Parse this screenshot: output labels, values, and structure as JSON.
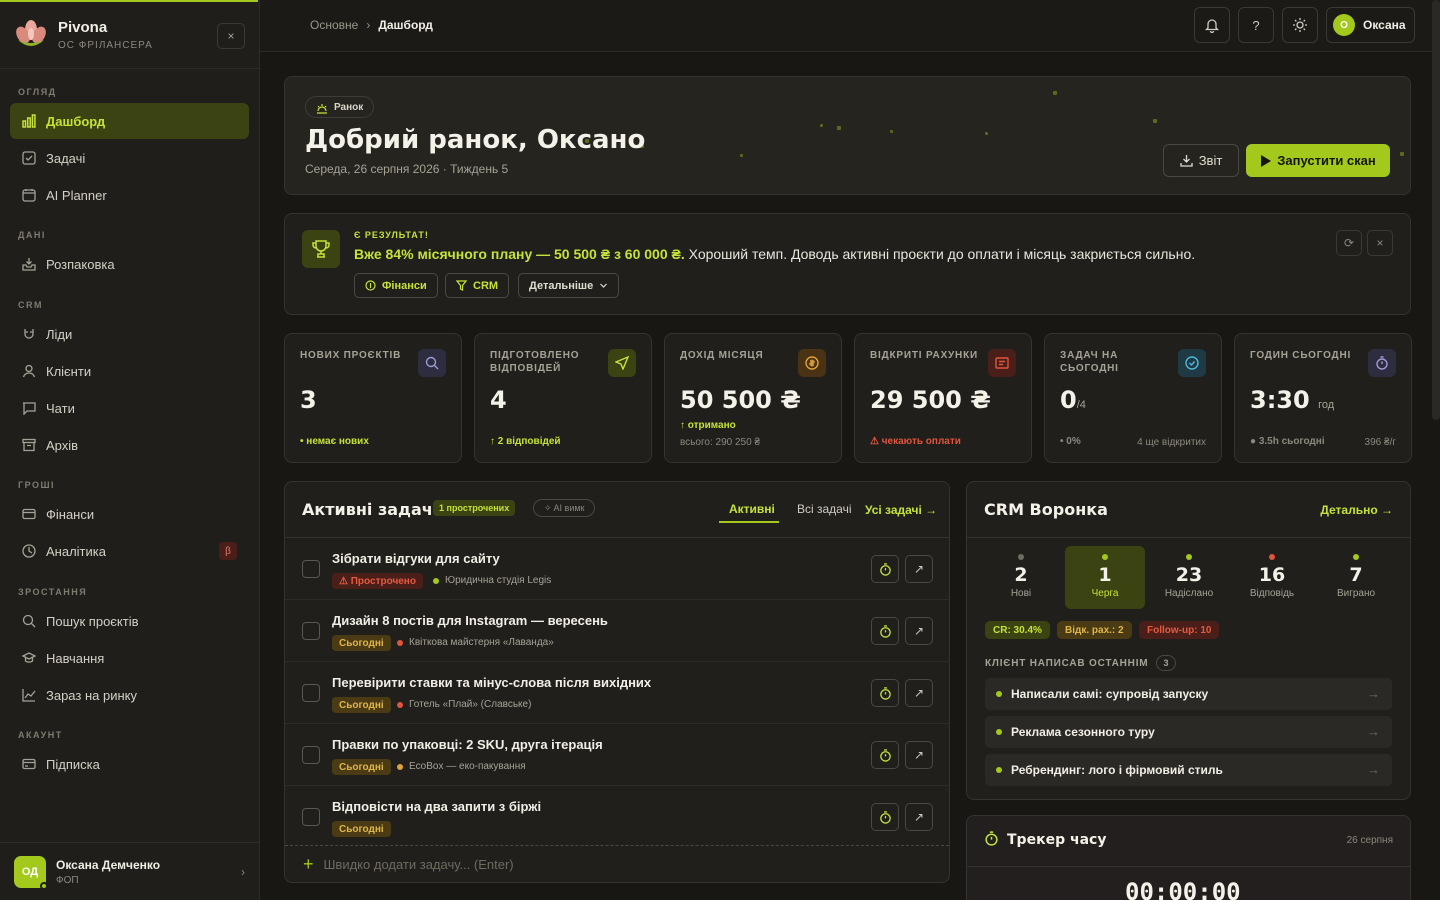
{
  "app": {
    "name": "Pivona",
    "subtitle": "ОС ФРІЛАНСЕРА",
    "close_glyph": "×"
  },
  "sidebar": {
    "sections": [
      {
        "label": "ОГЛЯД"
      },
      {
        "label": "ДАНІ"
      },
      {
        "label": "CRM"
      },
      {
        "label": "ГРОШІ"
      },
      {
        "label": "ЗРОСТАННЯ"
      },
      {
        "label": "АКАУНТ"
      }
    ],
    "items": [
      {
        "label": "Дашборд",
        "icon": "bar-chart-icon",
        "active": true
      },
      {
        "label": "Задачі",
        "icon": "checkbox-icon"
      },
      {
        "label": "AI Planner",
        "icon": "calendar-icon"
      },
      {
        "label": "Розпаковка",
        "icon": "inbox-icon"
      },
      {
        "label": "Ліди",
        "icon": "magnet-icon"
      },
      {
        "label": "Клієнти",
        "icon": "user-icon"
      },
      {
        "label": "Чати",
        "icon": "chat-icon"
      },
      {
        "label": "Архів",
        "icon": "archive-icon"
      },
      {
        "label": "Фінанси",
        "icon": "wallet-icon"
      },
      {
        "label": "Аналітика",
        "icon": "clock-chart-icon",
        "badge": "β"
      },
      {
        "label": "Пошук проєктів",
        "icon": "search-icon"
      },
      {
        "label": "Навчання",
        "icon": "graduation-icon"
      },
      {
        "label": "Зараз на ринку",
        "icon": "trend-icon"
      },
      {
        "label": "Підписка",
        "icon": "card-icon"
      }
    ],
    "user": {
      "initials": "ОД",
      "name": "Оксана Демченко",
      "role": "ФОП",
      "chevron": "›"
    }
  },
  "topbar": {
    "breadcrumb": [
      "Основне",
      "Дашборд"
    ],
    "breadcrumb_sep": "›",
    "help": "?",
    "user_initial": "О",
    "user_name": "Оксана"
  },
  "hero": {
    "pill": "Ранок",
    "title": "Добрий ранок, Оксано",
    "date": "Середа, 26 серпня 2026 · Тиждень 5",
    "report_btn": "Звіт",
    "scan_btn": "Запустити скан"
  },
  "alert": {
    "kicker": "Є РЕЗУЛЬТАТ!",
    "highlight": "Вже 84% місячного плану — 50 500 ₴ з 60 000 ₴.",
    "text": " Хороший темп. Доводь активні проєкти до оплати і місяць закриється сильно.",
    "chips": [
      "Фінанси",
      "CRM",
      "Детальніше"
    ],
    "refresh_glyph": "⟳",
    "close_glyph": "×"
  },
  "stats": [
    {
      "label": "НОВИХ ПРОЄКТІВ",
      "value": "3",
      "unit": "",
      "foot": "• немає нових",
      "sub": "",
      "right": "",
      "icon": "search-icon"
    },
    {
      "label": "ПІДГОТОВЛЕНО ВІДПОВІДЕЙ",
      "value": "4",
      "unit": "",
      "foot": "↑ 2 відповідей",
      "sub": "",
      "right": "",
      "icon": "send-icon"
    },
    {
      "label": "ДОХІД МІСЯЦЯ",
      "value": "50 500 ₴",
      "unit": "",
      "foot": "↑ отримано",
      "sub": "всього: 290 250 ₴",
      "right": "",
      "icon": "coin-icon"
    },
    {
      "label": "ВІДКРИТІ РАХУНКИ",
      "value": "29 500 ₴",
      "unit": "",
      "foot": "⚠ чекають оплати",
      "sub": "",
      "right": "",
      "icon": "invoice-icon"
    },
    {
      "label": "ЗАДАЧ НА СЬОГОДНІ",
      "value": "0",
      "unit": "/4",
      "foot": "• 0%",
      "sub": "",
      "right": "4 ще відкритих",
      "icon": "check-circle-icon"
    },
    {
      "label": "ГОДИН СЬОГОДНІ",
      "value": "3:30",
      "unit": "год",
      "foot": "● 3.5h сьогодні",
      "sub": "",
      "right": "396 ₴/г",
      "icon": "stopwatch-icon"
    }
  ],
  "tasks": {
    "title": "Активні задачі",
    "overdue_badge": "1 прострочених",
    "ai_badge": "✧ AI вимк",
    "tabs": [
      "Активні",
      "Всі задачі"
    ],
    "all_link": "Усі задачі →",
    "items": [
      {
        "title": "Зібрати відгуки для сайту",
        "tag": "⚠ Прострочено",
        "tag_kind": "over",
        "client": "Юридична студія Legis",
        "dot": "#a3c91c"
      },
      {
        "title": "Дизайн 8 постів для Instagram — вересень",
        "tag": "Сьогодні",
        "tag_kind": "today",
        "client": "Квіткова майстерня «Лаванда»",
        "dot": "#e0553e"
      },
      {
        "title": "Перевірити ставки та мінус-слова після вихідних",
        "tag": "Сьогодні",
        "tag_kind": "today",
        "client": "Готель «Плай» (Славське)",
        "dot": "#e0553e"
      },
      {
        "title": "Правки по упаковці: 2 SKU, друга ітерація",
        "tag": "Сьогодні",
        "tag_kind": "today",
        "client": "EcoBox — еко-пакування",
        "dot": "#e0a13a"
      },
      {
        "title": "Відповісти на два запити з біржі",
        "tag": "Сьогодні",
        "tag_kind": "today",
        "client": "",
        "dot": ""
      }
    ],
    "open_glyph": "↗",
    "quick_plus": "+",
    "quick_add": "Швидко додати задачу... (Enter)"
  },
  "crm": {
    "title": "CRM Воронка",
    "link": "Детально →",
    "stages": [
      {
        "value": "2",
        "label": "Нові",
        "dot": "#6f6b61",
        "active": false
      },
      {
        "value": "1",
        "label": "Черга",
        "dot": "#a3c91c",
        "active": true
      },
      {
        "value": "23",
        "label": "Надіслано",
        "dot": "#a3c91c",
        "active": false
      },
      {
        "value": "16",
        "label": "Відповідь",
        "dot": "#e0553e",
        "active": false
      },
      {
        "value": "7",
        "label": "Виграно",
        "dot": "#a3c91c",
        "active": false
      }
    ],
    "kpis": [
      "CR: 30.4%",
      "Відк. рах.: 2",
      "Follow-up: 10"
    ],
    "recent_label": "КЛІЄНТ НАПИСАВ ОСТАННІМ",
    "recent_count": "3",
    "row_arrow": "→",
    "recent": [
      "Написали самі: супровід запуску",
      "Реклама сезонного туру",
      "Ребрендинг: лого і фірмовий стиль"
    ]
  },
  "timer": {
    "title": "Трекер часу",
    "date": "26 серпня",
    "clock": "00:00:00"
  },
  "colors": {
    "accent": "#a3c91c",
    "danger": "#e0553e",
    "warning": "#e0b54a"
  }
}
